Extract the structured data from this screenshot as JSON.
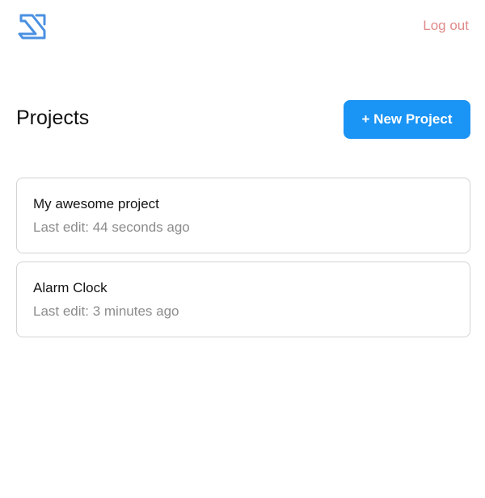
{
  "header": {
    "logo_icon": "swirl-logo-icon",
    "logout_label": "Log out"
  },
  "main": {
    "title": "Projects",
    "new_project_label": "+ New Project",
    "projects": [
      {
        "name": "My awesome project",
        "last_edit": "Last edit: 44 seconds ago"
      },
      {
        "name": "Alarm Clock",
        "last_edit": "Last edit: 3 minutes ago"
      }
    ]
  },
  "colors": {
    "accent": "#1a94f5",
    "logout": "#e08a8a",
    "logo": "#4a90e2"
  }
}
